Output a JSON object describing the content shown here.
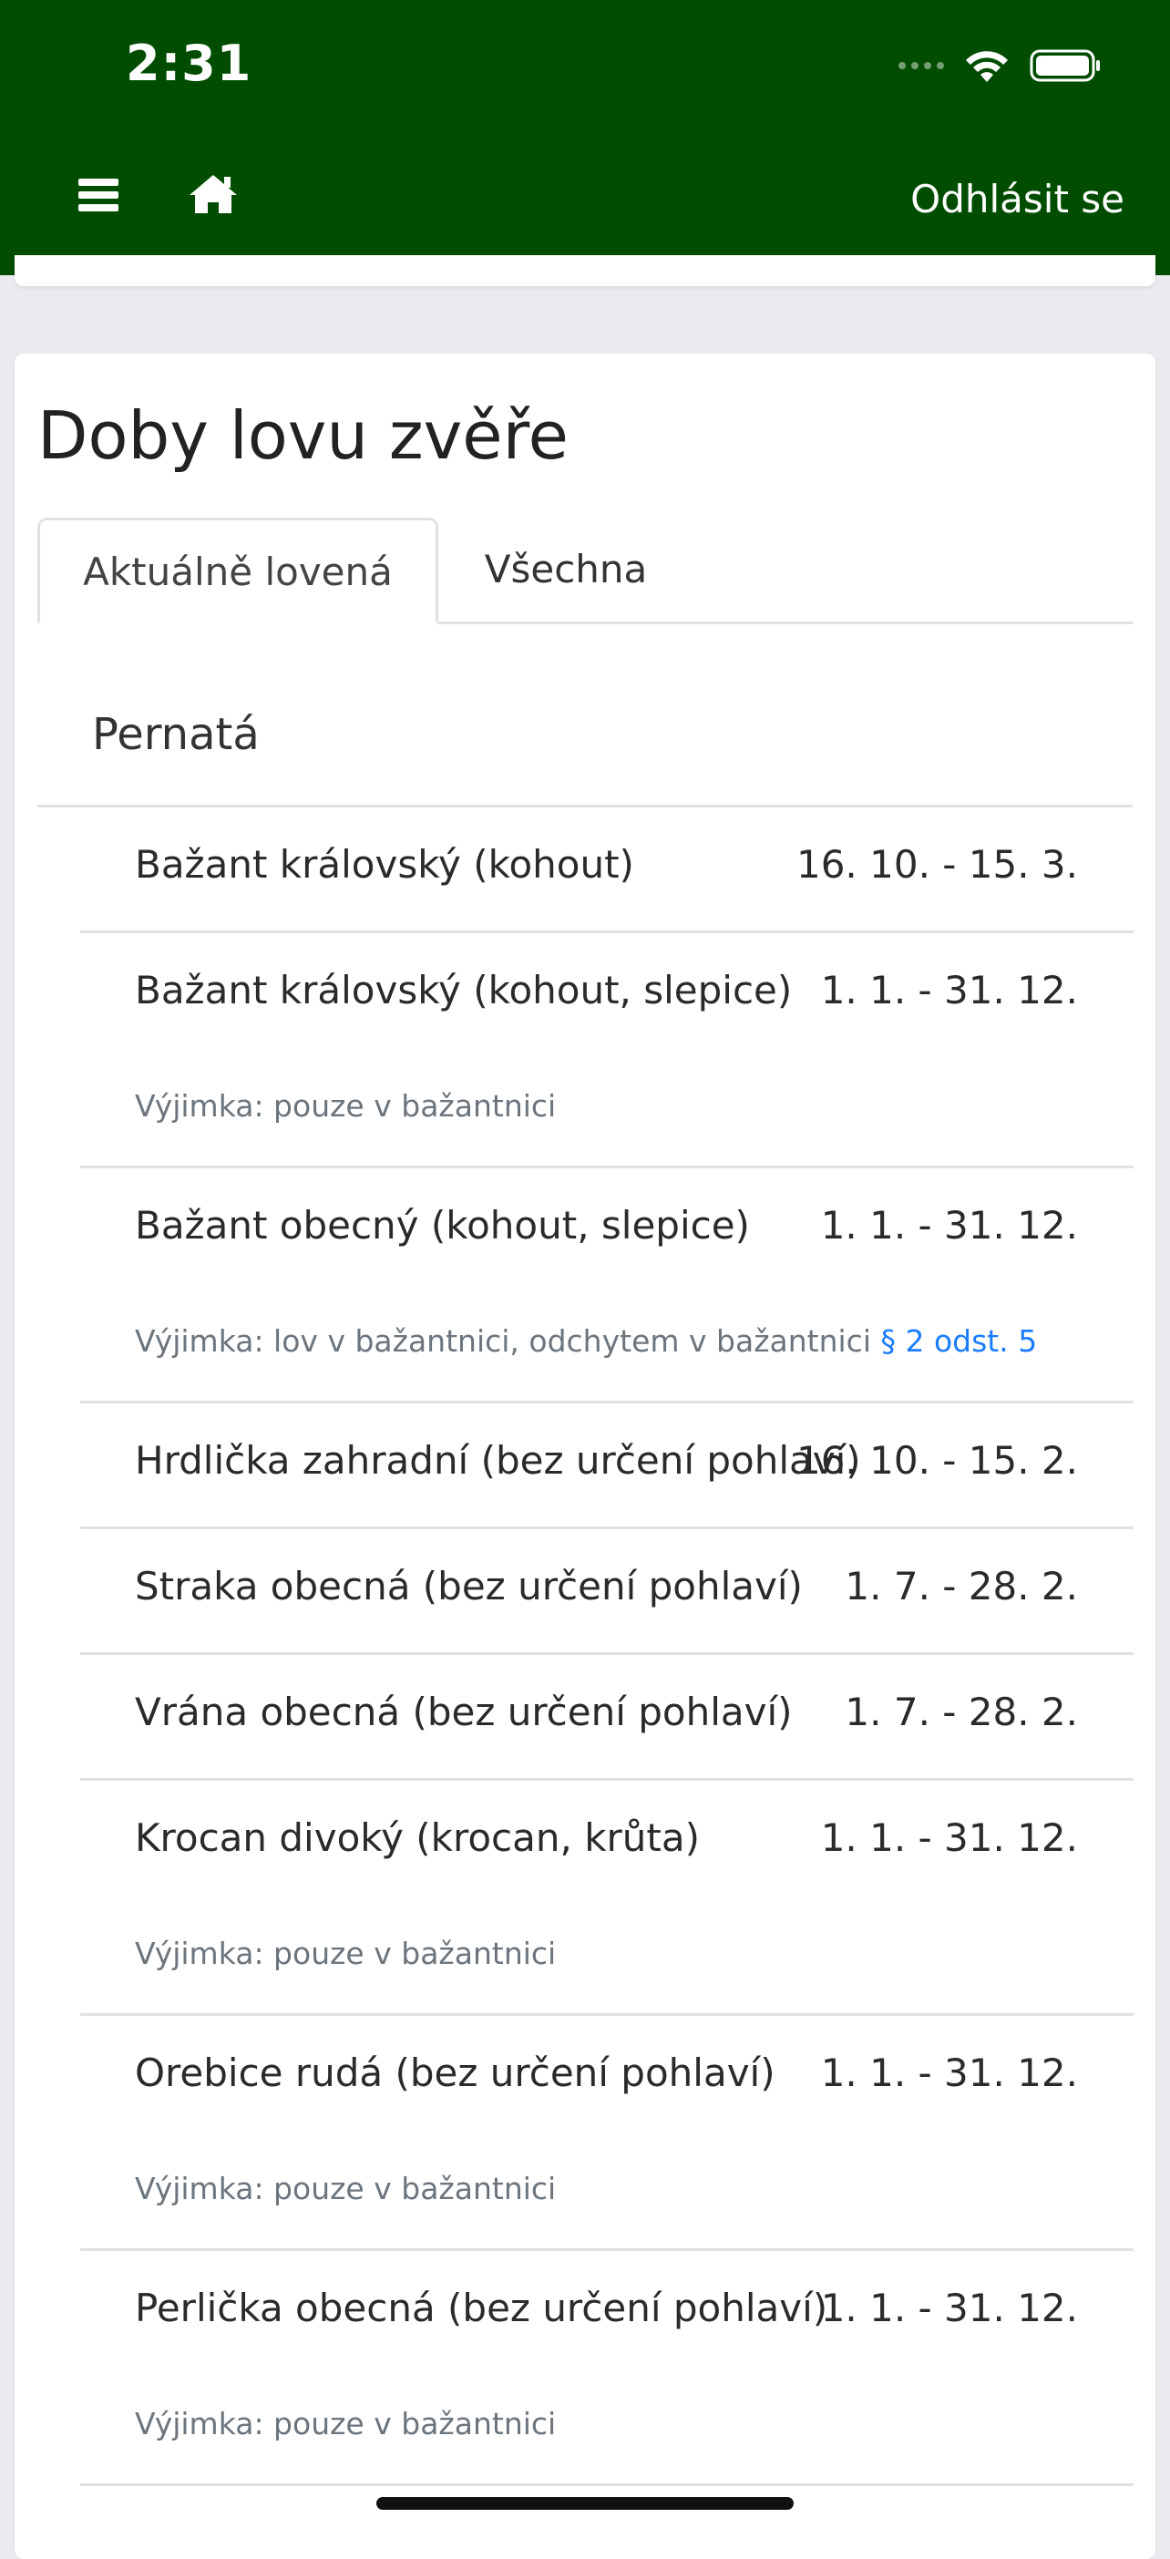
{
  "status_bar": {
    "time": "2:31"
  },
  "nav": {
    "logout_label": "Odhlásit se"
  },
  "page": {
    "title": "Doby lovu zvěře"
  },
  "tabs": [
    {
      "label": "Aktuálně lovená",
      "active": true
    },
    {
      "label": "Všechna",
      "active": false
    }
  ],
  "section": {
    "title": "Pernatá"
  },
  "rows": [
    {
      "name": "Bažant královský (kohout)",
      "dates": "16. 10. - 15. 3."
    },
    {
      "name": "Bažant královský (kohout, slepice)",
      "dates": "1. 1. - 31. 12.",
      "note": "Výjimka: pouze v bažantnici"
    },
    {
      "name": "Bažant obecný (kohout, slepice)",
      "dates": "1. 1. - 31. 12.",
      "note": "Výjimka: lov v bažantnici, odchytem v bažantnici",
      "note_link": "§ 2 odst. 5"
    },
    {
      "name": "Hrdlička zahradní (bez určení pohlaví)",
      "dates": "16. 10. - 15. 2."
    },
    {
      "name": "Straka obecná (bez určení pohlaví)",
      "dates": "1. 7. - 28. 2."
    },
    {
      "name": "Vrána obecná (bez určení pohlaví)",
      "dates": "1. 7. - 28. 2."
    },
    {
      "name": "Krocan divoký (krocan, krůta)",
      "dates": "1. 1. - 31. 12.",
      "note": "Výjimka: pouze v bažantnici"
    },
    {
      "name": "Orebice rudá (bez určení pohlaví)",
      "dates": "1. 1. - 31. 12.",
      "note": "Výjimka: pouze v bažantnici"
    },
    {
      "name": "Perlička obecná (bez určení pohlaví)",
      "dates": "1. 1. - 31. 12.",
      "note": "Výjimka: pouze v bažantnici"
    }
  ],
  "colors": {
    "header_bg": "#004d00",
    "page_bg": "#e9ebef",
    "link": "#1a7dff",
    "muted_text": "#6c757d"
  },
  "icons": {
    "menu": "hamburger-menu-icon",
    "home": "home-icon",
    "signal": "cellular-signal-icon",
    "wifi": "wifi-icon",
    "battery": "battery-icon"
  }
}
